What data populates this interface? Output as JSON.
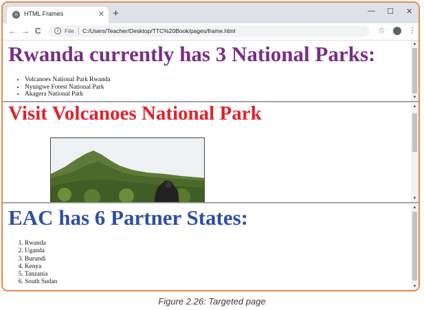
{
  "browser": {
    "tab_title": "HTML Frames",
    "tab_close": "✕",
    "new_tab": "+",
    "window_controls": {
      "minimize": "—",
      "maximize": "☐",
      "close": "✕"
    },
    "nav": {
      "back": "←",
      "forward": "→",
      "reload": "C"
    },
    "address": {
      "info": "i",
      "file_label": "File",
      "url": "C:/Users/Teacher/Desktop/TTC%20Book/pages/frame.html"
    },
    "star": "☆",
    "menu": "⋮",
    "icons": [
      "globe-icon",
      "back-arrow-icon",
      "forward-arrow-icon",
      "reload-icon",
      "info-icon",
      "star-icon",
      "profile-icon",
      "kebab-menu-icon"
    ]
  },
  "frame1": {
    "heading": "Rwanda currently has 3 National Parks:",
    "heading_color": "#7a2e85",
    "items": [
      "Volcanoes National Park Rwanda",
      "Nyungwe Forest National Park",
      "Akagera National Park"
    ]
  },
  "frame2": {
    "heading": "Visit Volcanoes National Park",
    "heading_color": "#e0232a",
    "image_subject": "gorilla in green forest on a mountain slope"
  },
  "frame3": {
    "heading": "EAC has 6 Partner States:",
    "heading_color": "#2e4fa0",
    "items": [
      "Rwanda",
      "Uganda",
      "Burundi",
      "Kenya",
      "Tanzania",
      "South Sudan"
    ]
  },
  "scroll_arrows": {
    "up": "▲",
    "down": "▼"
  },
  "caption": "Figure 2.26: Targeted page",
  "colors": {
    "window_border": "#e8864a",
    "tabstrip": "#dee1e6"
  }
}
